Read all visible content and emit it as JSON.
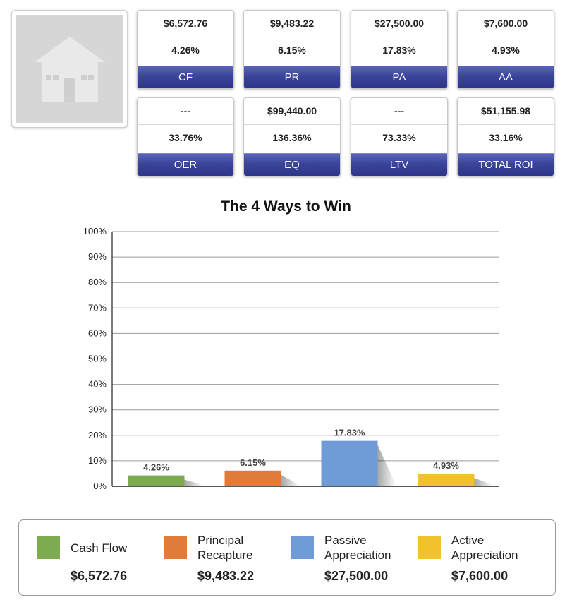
{
  "metrics_row1": [
    {
      "amount": "$6,572.76",
      "percent": "4.26%",
      "label": "CF"
    },
    {
      "amount": "$9,483.22",
      "percent": "6.15%",
      "label": "PR"
    },
    {
      "amount": "$27,500.00",
      "percent": "17.83%",
      "label": "PA"
    },
    {
      "amount": "$7,600.00",
      "percent": "4.93%",
      "label": "AA"
    }
  ],
  "metrics_row2": [
    {
      "amount": "---",
      "percent": "33.76%",
      "label": "OER"
    },
    {
      "amount": "$99,440.00",
      "percent": "136.36%",
      "label": "EQ"
    },
    {
      "amount": "---",
      "percent": "73.33%",
      "label": "LTV"
    },
    {
      "amount": "$51,155.98",
      "percent": "33.16%",
      "label": "TOTAL ROI"
    }
  ],
  "thumbnail": {
    "icon": "house-icon"
  },
  "chart_data": {
    "type": "bar",
    "title": "The 4 Ways to Win",
    "categories": [
      "Cash Flow",
      "Principal Recapture",
      "Passive Appreciation",
      "Active Appreciation"
    ],
    "values": [
      4.26,
      6.15,
      17.83,
      4.93
    ],
    "value_labels": [
      "4.26%",
      "6.15%",
      "17.83%",
      "4.93%"
    ],
    "colors": [
      "#7dab4f",
      "#e07b39",
      "#6f9bd6",
      "#f2c12e"
    ],
    "ylim": [
      0,
      100
    ],
    "yticks": [
      "0%",
      "10%",
      "20%",
      "30%",
      "40%",
      "50%",
      "60%",
      "70%",
      "80%",
      "90%",
      "100%"
    ],
    "grid": true,
    "legend_position": "bottom"
  },
  "legend": [
    {
      "name": "Cash Flow",
      "value": "$6,572.76",
      "color": "#7dab4f"
    },
    {
      "name": "Principal Recapture",
      "value": "$9,483.22",
      "color": "#e07b39"
    },
    {
      "name": "Passive Appreciation",
      "value": "$27,500.00",
      "color": "#6f9bd6"
    },
    {
      "name": "Active Appreciation",
      "value": "$7,600.00",
      "color": "#f2c12e"
    }
  ]
}
